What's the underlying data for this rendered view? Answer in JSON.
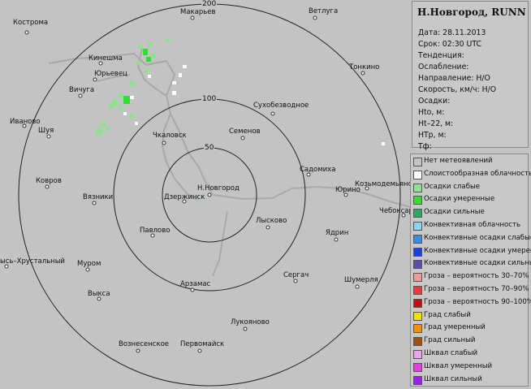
{
  "info": {
    "station": "Н.Новгород, RUNN",
    "date": "Дата: 28.11.2013",
    "time": "Срок: 02:30 UTC",
    "trend": "Тенденция:",
    "attenuation": "Ослабление:",
    "direction": "Направление: Н/О",
    "speed": "Скорость, км/ч: Н/О",
    "precip": "Осадки:",
    "hto": "Hto, м:",
    "ht22": "Ht–22, м:",
    "htr": "HTр, м:",
    "tf": "Тф:"
  },
  "rings": {
    "r50": "50",
    "r100": "100",
    "r200": "200"
  },
  "cities": [
    "Кострома",
    "Макарьев",
    "Ветлуга",
    "Кинешма",
    "Юрьевец",
    "Тонкино",
    "Вичуга",
    "Иваново",
    "Шуя",
    "Сухобезводное",
    "Чкаловск",
    "Семенов",
    "Садомиха",
    "Козьмодемьянск",
    "Юрино",
    "Чебоксары",
    "Ковров",
    "Вязники",
    "Н.Новгород",
    "Дзержинск",
    "Лысково",
    "Павлово",
    "Ядрин",
    "ысь–Хрустальный",
    "Муром",
    "Сергач",
    "Шумерля",
    "Арзамас",
    "Выкса",
    "Лукояново",
    "Вознесенское",
    "Первомайск"
  ],
  "legend": [
    {
      "label": "Нет метеоявлений",
      "color": "#c3c3c3"
    },
    {
      "label": "Слоистообразная облачность",
      "color": "#ffffff"
    },
    {
      "label": "Осадки слабые",
      "color": "#8fe08f"
    },
    {
      "label": "Осадки умеренные",
      "color": "#33dd33"
    },
    {
      "label": "Осадки сильные",
      "color": "#2aa96a"
    },
    {
      "label": "Конвективная облачность",
      "color": "#8ad4ee"
    },
    {
      "label": "Конвективные осадки слабые",
      "color": "#3a8ee0"
    },
    {
      "label": "Конвективные осадки умерен.",
      "color": "#1a40e0"
    },
    {
      "label": "Конвективные осадки сильные",
      "color": "#5a50b0"
    },
    {
      "label": "Гроза – вероятность 30–70%",
      "color": "#f09a9a"
    },
    {
      "label": "Гроза – вероятность 70–90%",
      "color": "#f03a3a"
    },
    {
      "label": "Гроза – вероятность 90–100%",
      "color": "#c01010"
    },
    {
      "label": "Град слабый",
      "color": "#f0e000"
    },
    {
      "label": "Град умеренный",
      "color": "#f09010"
    },
    {
      "label": "Град сильный",
      "color": "#a05010"
    },
    {
      "label": "Шквал слабый",
      "color": "#e9a6f0"
    },
    {
      "label": "Шквал умеренный",
      "color": "#e040e0"
    },
    {
      "label": "Шквал сильный",
      "color": "#a020e0"
    }
  ]
}
